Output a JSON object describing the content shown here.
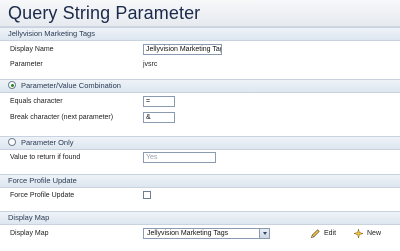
{
  "window": {
    "title": "Query String Parameter"
  },
  "sections": {
    "main": {
      "header": "Jellyvision Marketing Tags"
    },
    "param_value": {
      "header": "Parameter/Value Combination"
    },
    "param_only": {
      "header": "Parameter Only"
    },
    "force_profile": {
      "header": "Force Profile Update"
    },
    "display_map": {
      "header": "Display Map"
    }
  },
  "fields": {
    "display_name": {
      "label": "Display Name",
      "value": "Jellyvision Marketing Tags"
    },
    "parameter": {
      "label": "Parameter",
      "value": "jvsrc"
    },
    "equals_char": {
      "label": "Equals character",
      "value": "="
    },
    "break_char": {
      "label": "Break character (next parameter)",
      "value": "&"
    },
    "return_value": {
      "label": "Value to return if found",
      "placeholder": "Yes"
    },
    "force_profile_update": {
      "label": "Force Profile Update",
      "checked": false
    },
    "display_map": {
      "label": "Display Map",
      "selected": "Jellyvision Marketing Tags"
    }
  },
  "actions": {
    "edit": "Edit",
    "new": "New"
  },
  "colors": {
    "header_text": "#2b3b55",
    "radio_selected": "#2a8a2a",
    "title_text": "#1c2a4a"
  }
}
